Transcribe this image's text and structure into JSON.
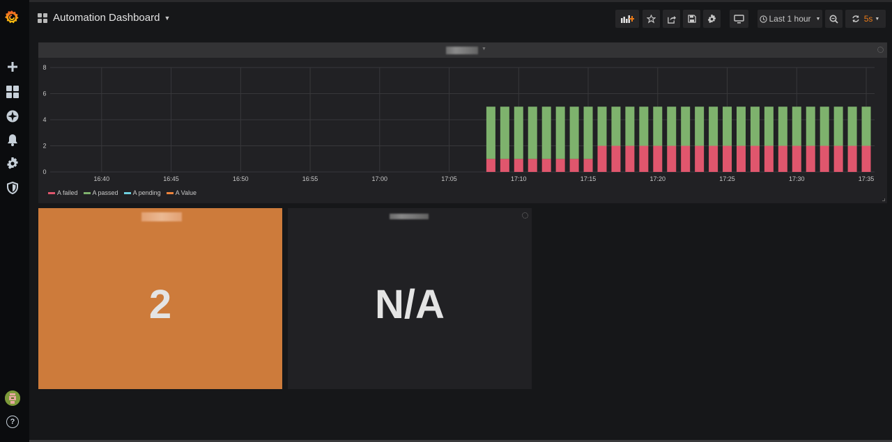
{
  "app": {
    "title": "Automation Dashboard",
    "brand_color": "#f46800"
  },
  "sidemenu": {
    "items": [
      {
        "name": "create",
        "icon": "plus-icon"
      },
      {
        "name": "dashboards",
        "icon": "dashboards-icon"
      },
      {
        "name": "explore",
        "icon": "compass-icon"
      },
      {
        "name": "alerting",
        "icon": "bell-icon"
      },
      {
        "name": "configuration",
        "icon": "gear-icon"
      },
      {
        "name": "server-admin",
        "icon": "shield-icon"
      }
    ],
    "help_label": "?"
  },
  "toolbar": {
    "add_panel": "add-panel-icon",
    "star": "star-icon",
    "share": "share-icon",
    "save": "save-icon",
    "settings": "gear-icon",
    "tv_mode": "monitor-icon",
    "time_range_label": "Last 1 hour",
    "zoom_out": "zoom-out-icon",
    "refresh_interval": "5s",
    "refresh_color": "#eb7b18"
  },
  "graph_panel": {
    "title_redacted": true,
    "legend": [
      {
        "label": "A failed",
        "color": "#e0566d"
      },
      {
        "label": "A passed",
        "color": "#7eb26d"
      },
      {
        "label": "A pending",
        "color": "#6ed0e0"
      },
      {
        "label": "A Value",
        "color": "#ef843c"
      }
    ]
  },
  "stat_panels": [
    {
      "title_redacted": true,
      "value": "2",
      "background": "#cd7b3b"
    },
    {
      "title_redacted": true,
      "value": "N/A",
      "background": "#212124"
    }
  ],
  "chart_data": {
    "type": "bar",
    "stacked": true,
    "title": "",
    "xlabel": "",
    "ylabel": "",
    "ylim": [
      0,
      8
    ],
    "yticks": [
      "0",
      "2",
      "4",
      "6",
      "8"
    ],
    "xticks": [
      "16:40",
      "16:45",
      "16:50",
      "16:55",
      "17:00",
      "17:05",
      "17:10",
      "17:15",
      "17:20",
      "17:25",
      "17:30",
      "17:35"
    ],
    "x_range_minutes": [
      "16:37",
      "17:36"
    ],
    "grid": true,
    "legend_position": "bottom-left",
    "bar_times": [
      "17:08",
      "17:09",
      "17:10",
      "17:11",
      "17:12",
      "17:13",
      "17:14",
      "17:15",
      "17:16",
      "17:17",
      "17:18",
      "17:19",
      "17:20",
      "17:21",
      "17:22",
      "17:23",
      "17:24",
      "17:25",
      "17:26",
      "17:27",
      "17:28",
      "17:29",
      "17:30",
      "17:31",
      "17:32",
      "17:33",
      "17:34",
      "17:35"
    ],
    "series": [
      {
        "name": "A failed",
        "color": "#e0566d",
        "values": [
          1,
          1,
          1,
          1,
          1,
          1,
          1,
          1,
          2,
          2,
          2,
          2,
          2,
          2,
          2,
          2,
          2,
          2,
          2,
          2,
          2,
          2,
          2,
          2,
          2,
          2,
          2,
          2
        ]
      },
      {
        "name": "A passed",
        "color": "#7eb26d",
        "values": [
          4,
          4,
          4,
          4,
          4,
          4,
          4,
          4,
          3,
          3,
          3,
          3,
          3,
          3,
          3,
          3,
          3,
          3,
          3,
          3,
          3,
          3,
          3,
          3,
          3,
          3,
          3,
          3
        ]
      },
      {
        "name": "A pending",
        "color": "#6ed0e0",
        "values": [
          0,
          0,
          0,
          0,
          0,
          0,
          0,
          0,
          0,
          0,
          0,
          0,
          0,
          0,
          0,
          0,
          0,
          0,
          0,
          0,
          0,
          0,
          0,
          0,
          0,
          0,
          0,
          0
        ]
      },
      {
        "name": "A Value",
        "color": "#ef843c",
        "values": []
      }
    ]
  }
}
